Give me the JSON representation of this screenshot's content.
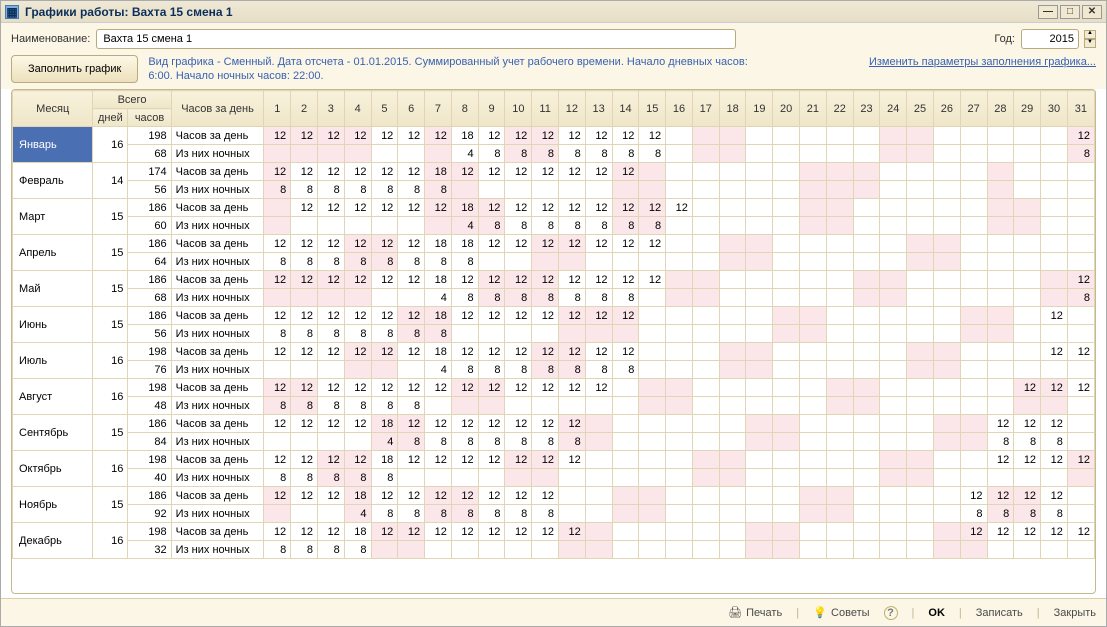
{
  "window": {
    "title": "Графики работы: Вахта 15 смена 1"
  },
  "form": {
    "name_label": "Наименование:",
    "name_value": "Вахта 15 смена 1",
    "year_label": "Год:",
    "year_value": "2015",
    "fill_button": "Заполнить график",
    "info_text": "Вид графика - Сменный. Дата отсчета - 01.01.2015. Суммированный учет рабочего времени. Начало дневных часов: 6:00. Начало ночных часов: 22:00.",
    "edit_params_link": "Изменить параметры заполнения графика..."
  },
  "headers": {
    "month": "Месяц",
    "total": "Всего",
    "days": "дней",
    "hours": "часов",
    "hours_per_day": "Часов за день",
    "row_hours": "Часов за день",
    "row_night": "Из них ночных"
  },
  "footer": {
    "print": "Печать",
    "tips": "Советы",
    "help": "?",
    "ok": "OK",
    "save": "Записать",
    "close": "Закрыть"
  },
  "days": 31,
  "chart_data": {
    "type": "table",
    "title": "Часов за день / Из них ночных по дням месяца, 2015",
    "months": [
      {
        "name": "Январь",
        "days": 16,
        "hours": 198,
        "night_total": 68,
        "weekends": [
          1,
          2,
          3,
          4,
          7,
          10,
          11,
          17,
          18,
          24,
          25,
          31
        ],
        "h": {
          "1": 12,
          "2": 12,
          "3": 12,
          "4": 12,
          "5": 12,
          "6": 12,
          "7": 12,
          "8": 18,
          "9": 12,
          "10": 12,
          "11": 12,
          "12": 12,
          "13": 12,
          "14": 12,
          "15": 12,
          "31": 12
        },
        "n": {
          "8": 4,
          "9": 8,
          "10": 8,
          "11": 8,
          "12": 8,
          "13": 8,
          "14": 8,
          "15": 8,
          "31": 8
        }
      },
      {
        "name": "Февраль",
        "days": 14,
        "hours": 174,
        "night_total": 56,
        "weekends": [
          1,
          7,
          8,
          14,
          15,
          21,
          22,
          23,
          28
        ],
        "h": {
          "1": 12,
          "2": 12,
          "3": 12,
          "4": 12,
          "5": 12,
          "6": 12,
          "7": 18,
          "8": 12,
          "9": 12,
          "10": 12,
          "11": 12,
          "12": 12,
          "13": 12,
          "14": 12
        },
        "n": {
          "1": 8,
          "2": 8,
          "3": 8,
          "4": 8,
          "5": 8,
          "6": 8,
          "7": 8
        }
      },
      {
        "name": "Март",
        "days": 15,
        "hours": 186,
        "night_total": 60,
        "weekends": [
          1,
          7,
          8,
          9,
          14,
          15,
          21,
          22,
          28,
          29
        ],
        "h": {
          "2": 12,
          "3": 12,
          "4": 12,
          "5": 12,
          "6": 12,
          "7": 12,
          "8": 18,
          "9": 12,
          "10": 12,
          "11": 12,
          "12": 12,
          "13": 12,
          "14": 12,
          "15": 12,
          "16": 12
        },
        "n": {
          "8": 4,
          "9": 8,
          "10": 8,
          "11": 8,
          "12": 8,
          "13": 8,
          "14": 8,
          "15": 8
        }
      },
      {
        "name": "Апрель",
        "days": 15,
        "hours": 186,
        "night_total": 64,
        "weekends": [
          4,
          5,
          11,
          12,
          18,
          19,
          25,
          26
        ],
        "h": {
          "1": 12,
          "2": 12,
          "3": 12,
          "4": 12,
          "5": 12,
          "6": 12,
          "7": 18,
          "8": 18,
          "9": 12,
          "10": 12,
          "11": 12,
          "12": 12,
          "13": 12,
          "14": 12,
          "15": 12
        },
        "n": {
          "1": 8,
          "2": 8,
          "3": 8,
          "4": 8,
          "5": 8,
          "6": 8,
          "7": 8,
          "8": 8
        }
      },
      {
        "name": "Май",
        "days": 15,
        "hours": 186,
        "night_total": 68,
        "weekends": [
          1,
          2,
          3,
          4,
          9,
          10,
          11,
          16,
          17,
          23,
          24,
          30,
          31
        ],
        "h": {
          "1": 12,
          "2": 12,
          "3": 12,
          "4": 12,
          "5": 12,
          "6": 12,
          "7": 18,
          "8": 12,
          "9": 12,
          "10": 12,
          "11": 12,
          "12": 12,
          "13": 12,
          "14": 12,
          "15": 12,
          "31": 12
        },
        "n": {
          "7": 4,
          "8": 8,
          "9": 8,
          "10": 8,
          "11": 8,
          "12": 8,
          "13": 8,
          "14": 8,
          "31": 8
        }
      },
      {
        "name": "Июнь",
        "days": 15,
        "hours": 186,
        "night_total": 56,
        "weekends": [
          6,
          7,
          12,
          13,
          14,
          20,
          21,
          27,
          28
        ],
        "h": {
          "1": 12,
          "2": 12,
          "3": 12,
          "4": 12,
          "5": 12,
          "6": 12,
          "7": 18,
          "8": 12,
          "9": 12,
          "10": 12,
          "11": 12,
          "12": 12,
          "13": 12,
          "14": 12,
          "30": 12
        },
        "n": {
          "1": 8,
          "2": 8,
          "3": 8,
          "4": 8,
          "5": 8,
          "6": 8,
          "7": 8
        }
      },
      {
        "name": "Июль",
        "days": 16,
        "hours": 198,
        "night_total": 76,
        "weekends": [
          4,
          5,
          11,
          12,
          18,
          19,
          25,
          26
        ],
        "h": {
          "1": 12,
          "2": 12,
          "3": 12,
          "4": 12,
          "5": 12,
          "6": 12,
          "7": 18,
          "8": 12,
          "9": 12,
          "10": 12,
          "11": 12,
          "12": 12,
          "13": 12,
          "14": 12,
          "30": 12,
          "31": 12
        },
        "n": {
          "7": 4,
          "8": 8,
          "9": 8,
          "10": 8,
          "11": 8,
          "12": 8,
          "13": 8,
          "14": 8
        }
      },
      {
        "name": "Август",
        "days": 16,
        "hours": 198,
        "night_total": 48,
        "weekends": [
          1,
          2,
          8,
          9,
          15,
          16,
          22,
          23,
          29,
          30
        ],
        "h": {
          "1": 12,
          "2": 12,
          "3": 12,
          "4": 12,
          "5": 12,
          "6": 12,
          "7": 12,
          "8": 12,
          "9": 12,
          "10": 12,
          "11": 12,
          "12": 12,
          "13": 12,
          "29": 12,
          "30": 12,
          "31": 12
        },
        "n": {
          "1": 8,
          "2": 8,
          "3": 8,
          "4": 8,
          "5": 8,
          "6": 8
        }
      },
      {
        "name": "Сентябрь",
        "days": 15,
        "hours": 186,
        "night_total": 84,
        "weekends": [
          5,
          6,
          12,
          13,
          19,
          20,
          26,
          27
        ],
        "h": {
          "1": 12,
          "2": 12,
          "3": 12,
          "4": 12,
          "5": 18,
          "6": 12,
          "7": 12,
          "8": 12,
          "9": 12,
          "10": 12,
          "11": 12,
          "12": 12,
          "28": 12,
          "29": 12,
          "30": 12
        },
        "n": {
          "5": 4,
          "6": 8,
          "7": 8,
          "8": 8,
          "9": 8,
          "10": 8,
          "11": 8,
          "12": 8,
          "28": 8,
          "29": 8,
          "30": 8
        }
      },
      {
        "name": "Октябрь",
        "days": 16,
        "hours": 198,
        "night_total": 40,
        "weekends": [
          3,
          4,
          10,
          11,
          17,
          18,
          24,
          25,
          31
        ],
        "h": {
          "1": 12,
          "2": 12,
          "3": 12,
          "4": 12,
          "5": 18,
          "6": 12,
          "7": 12,
          "8": 12,
          "9": 12,
          "10": 12,
          "11": 12,
          "12": 12,
          "28": 12,
          "29": 12,
          "30": 12,
          "31": 12
        },
        "n": {
          "1": 8,
          "2": 8,
          "3": 8,
          "4": 8,
          "5": 8
        }
      },
      {
        "name": "Ноябрь",
        "days": 15,
        "hours": 186,
        "night_total": 92,
        "weekends": [
          1,
          4,
          7,
          8,
          14,
          15,
          21,
          22,
          28,
          29
        ],
        "h": {
          "1": 12,
          "2": 12,
          "3": 12,
          "4": 18,
          "5": 12,
          "6": 12,
          "7": 12,
          "8": 12,
          "9": 12,
          "10": 12,
          "11": 12,
          "27": 12,
          "28": 12,
          "29": 12,
          "30": 12
        },
        "n": {
          "4": 4,
          "5": 8,
          "6": 8,
          "7": 8,
          "8": 8,
          "9": 8,
          "10": 8,
          "11": 8,
          "27": 8,
          "28": 8,
          "29": 8,
          "30": 8
        }
      },
      {
        "name": "Декабрь",
        "days": 16,
        "hours": 198,
        "night_total": 32,
        "weekends": [
          5,
          6,
          12,
          13,
          19,
          20,
          26,
          27
        ],
        "h": {
          "1": 12,
          "2": 12,
          "3": 12,
          "4": 18,
          "5": 12,
          "6": 12,
          "7": 12,
          "8": 12,
          "9": 12,
          "10": 12,
          "11": 12,
          "12": 12,
          "27": 12,
          "28": 12,
          "29": 12,
          "30": 12,
          "31": 12
        },
        "n": {
          "1": 8,
          "2": 8,
          "3": 8,
          "4": 8
        }
      }
    ]
  }
}
